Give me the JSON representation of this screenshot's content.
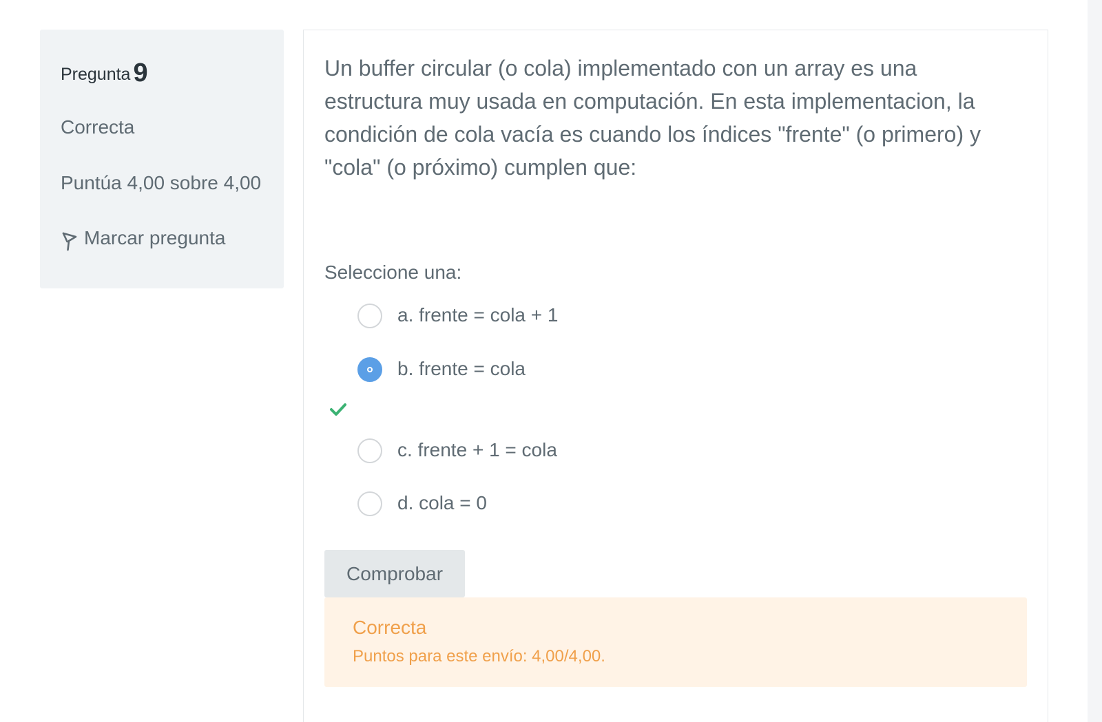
{
  "question_info": {
    "label": "Pregunta",
    "number": "9",
    "state": "Correcta",
    "grade": "Puntúa 4,00 sobre 4,00",
    "flag_label": "Marcar pregunta"
  },
  "question": {
    "text": "Un buffer circular (o cola)  implementado con un array es una estructura muy usada en computación.  En esta implementacion, la condición de cola vacía es cuando los índices \"frente\" (o primero) y \"cola\" (o próximo) cumplen que:",
    "prompt": "Seleccione una:",
    "options": [
      {
        "label": "a. frente = cola + 1",
        "selected": false
      },
      {
        "label": "b. frente = cola",
        "selected": true,
        "correct": true
      },
      {
        "label": "c. frente + 1 = cola",
        "selected": false
      },
      {
        "label": "d. cola = 0",
        "selected": false
      }
    ]
  },
  "actions": {
    "check_label": "Comprobar"
  },
  "feedback": {
    "title": "Correcta",
    "points": "Puntos para este envío: 4,00/4,00."
  },
  "colors": {
    "accent": "#5b9fe6",
    "correct": "#3bb273",
    "feedback_text": "#f0a04b",
    "feedback_bg": "#fff3e6"
  }
}
